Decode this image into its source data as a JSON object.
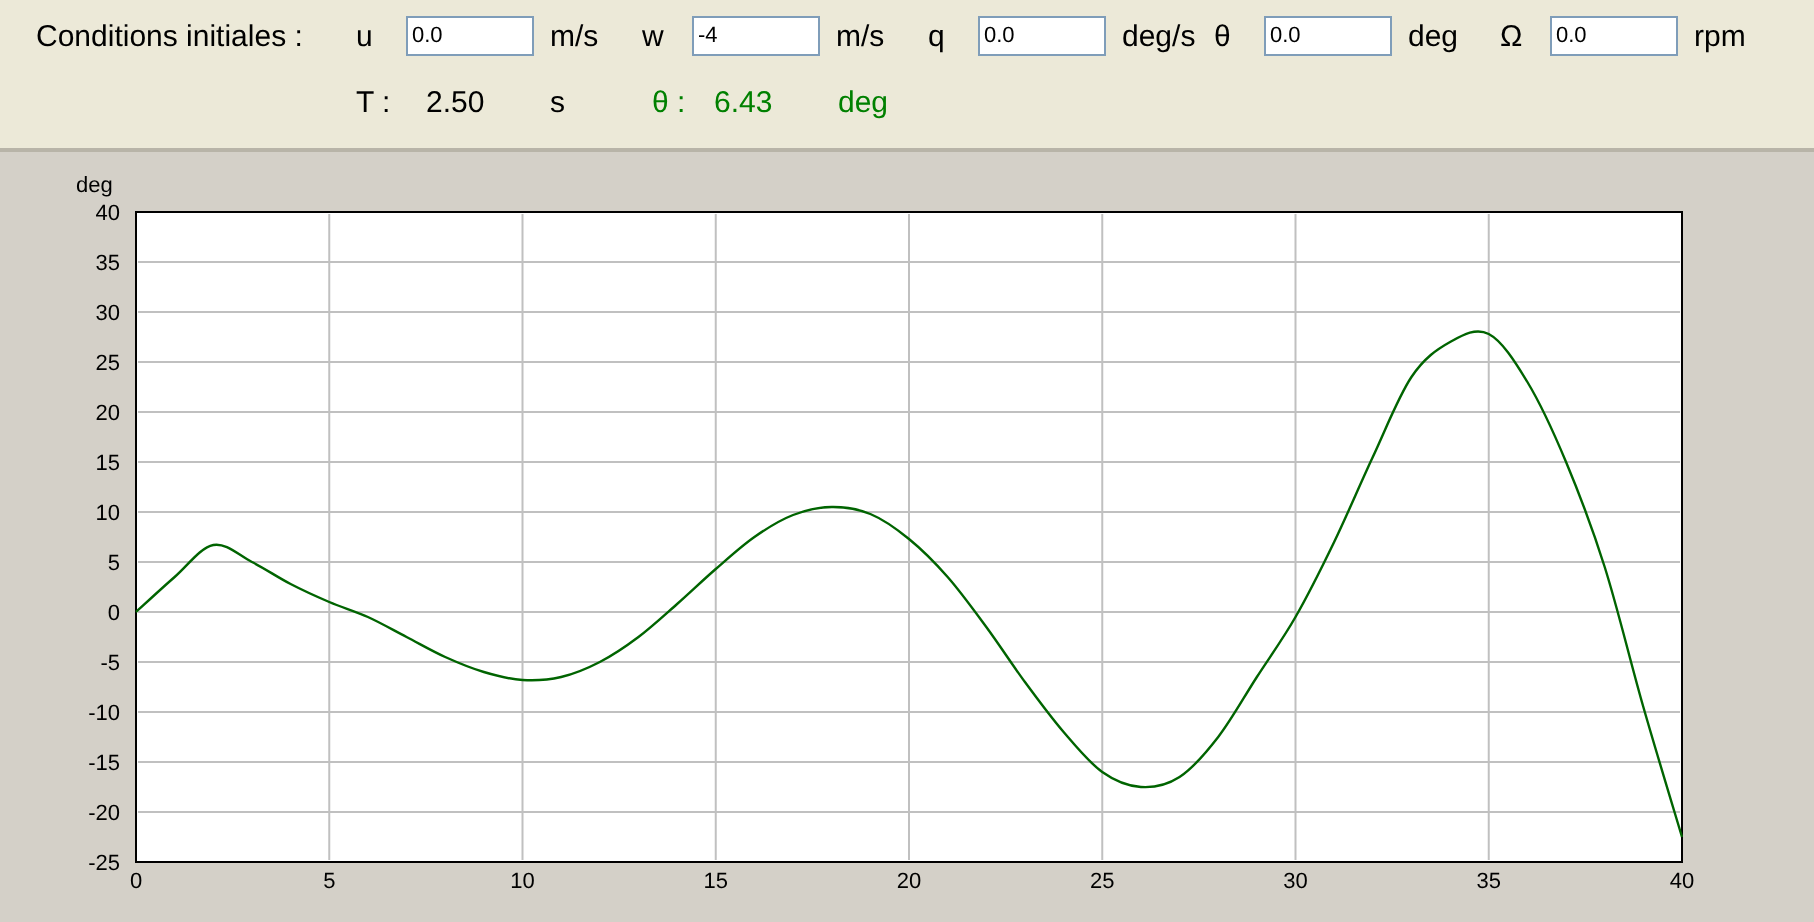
{
  "initial_conditions": {
    "label": "Conditions initiales :",
    "fields": [
      {
        "symbol": "u",
        "value": "0.0",
        "unit": "m/s"
      },
      {
        "symbol": "w",
        "value": "-4",
        "unit": "m/s"
      },
      {
        "symbol": "q",
        "value": "0.0",
        "unit": "deg/s"
      },
      {
        "symbol": "θ",
        "value": "0.0",
        "unit": "deg"
      },
      {
        "symbol": "Ω",
        "value": "0.0",
        "unit": "rpm"
      }
    ]
  },
  "readouts": [
    {
      "label": "T :",
      "value": "2.50",
      "unit": "s",
      "color": "#000000"
    },
    {
      "label": "θ :",
      "value": "6.43",
      "unit": "deg",
      "color": "#008000"
    }
  ],
  "chart": {
    "chart_data": {
      "type": "line",
      "ylabel": "deg",
      "xlim": [
        0,
        40
      ],
      "ylim": [
        -25,
        40
      ],
      "xticks": [
        0,
        5,
        10,
        15,
        20,
        25,
        30,
        35,
        40
      ],
      "yticks": [
        40,
        35,
        30,
        25,
        20,
        15,
        10,
        5,
        0,
        -5,
        -10,
        -15,
        -20,
        -25
      ],
      "x": [
        0,
        1,
        2,
        3,
        4,
        5,
        6,
        7,
        8,
        9,
        10,
        11,
        12,
        13,
        14,
        15,
        16,
        17,
        18,
        19,
        20,
        21,
        22,
        23,
        24,
        25,
        26,
        27,
        28,
        29,
        30,
        31,
        32,
        33,
        34,
        35,
        36,
        37,
        38,
        39,
        40
      ],
      "grid": true,
      "series": [
        {
          "color": "#006400",
          "values": [
            0,
            3.5,
            6.7,
            5,
            2.8,
            1,
            -0.5,
            -2.5,
            -4.5,
            -6,
            -6.8,
            -6.5,
            -5,
            -2.5,
            0.8,
            4.3,
            7.5,
            9.7,
            10.5,
            9.8,
            7.3,
            3.5,
            -1.5,
            -7,
            -12,
            -16,
            -17.5,
            -16.5,
            -12.5,
            -6.5,
            -0.5,
            7,
            15.5,
            23.5,
            27,
            27.8,
            23,
            15,
            4.5,
            -9.5,
            -22.5
          ]
        }
      ]
    }
  }
}
